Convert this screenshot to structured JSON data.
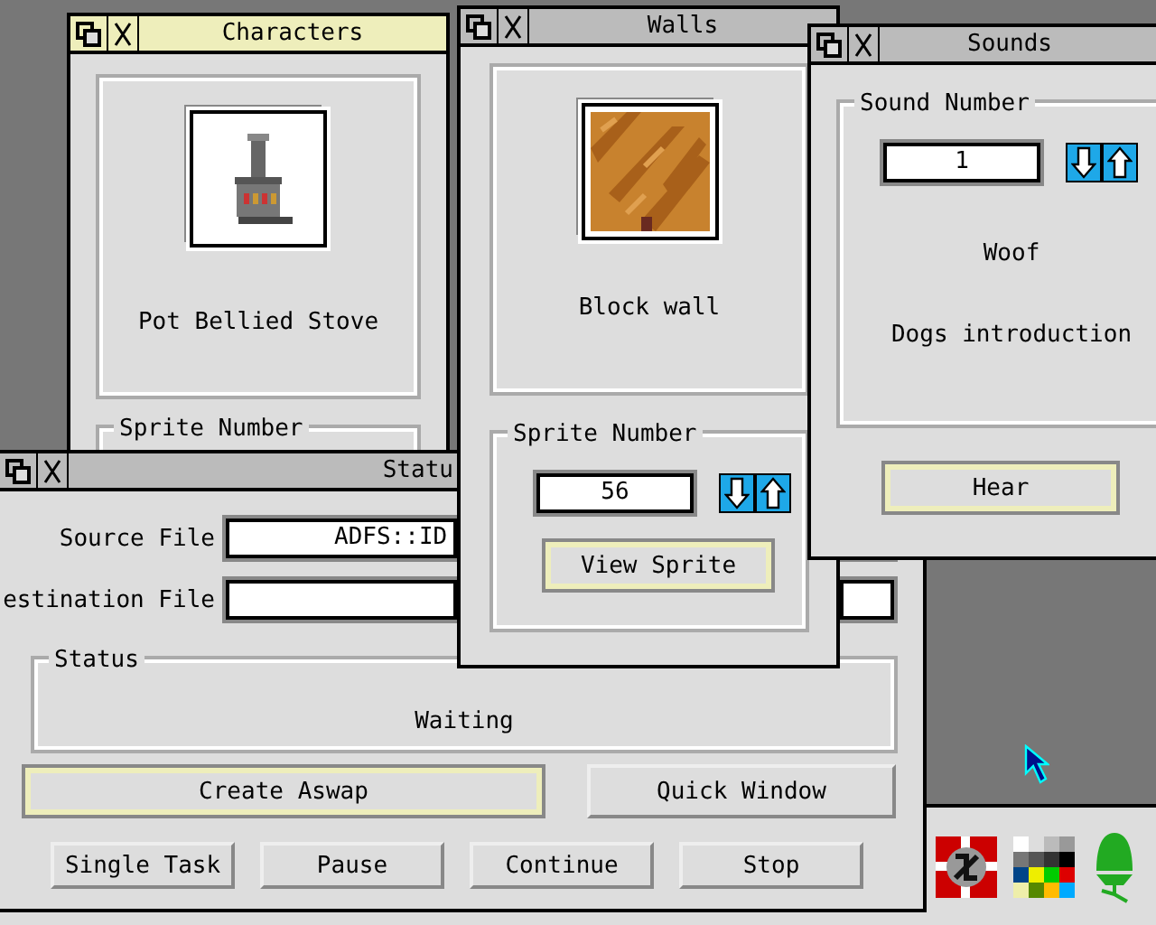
{
  "characters_window": {
    "title": "Characters",
    "focused": true,
    "sprite_caption": "Pot Bellied Stove",
    "group_label": "Sprite Number"
  },
  "status_window": {
    "title": "Statu",
    "focused": false,
    "source_label": "Source File",
    "source_value": "ADFS::ID",
    "destination_label": "estination File",
    "group_label": "Status",
    "status_text": "Waiting",
    "buttons": [
      {
        "label": "Create Aswap",
        "default": true
      },
      {
        "label": "Quick Window",
        "default": false
      }
    ],
    "task_buttons": [
      "Single Task",
      "Pause",
      "Continue",
      "Stop"
    ]
  },
  "walls_window": {
    "title": "Walls",
    "focused": false,
    "sprite_caption": "Block wall",
    "group_label": "Sprite Number",
    "value": "56",
    "button": {
      "label": "View Sprite",
      "default": true
    }
  },
  "sounds_window": {
    "title": "Sounds",
    "focused": false,
    "group_label": "Sound Number",
    "value": "1",
    "sound_name": "Woof",
    "description": "Dogs introduction",
    "button": {
      "label": "Hear",
      "default": true
    }
  }
}
